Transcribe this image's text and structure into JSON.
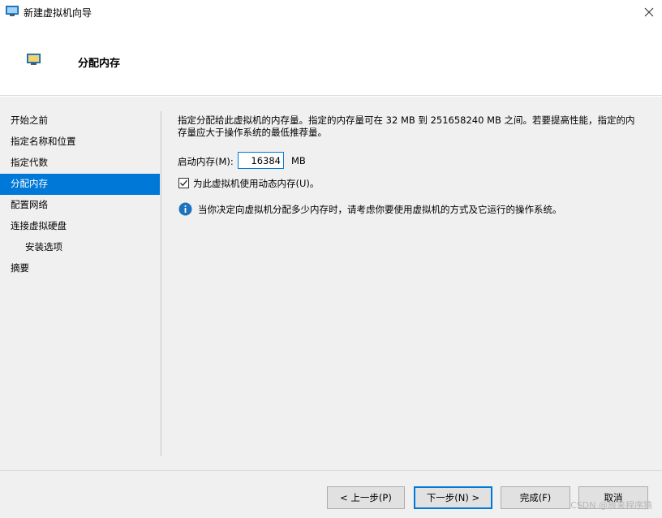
{
  "window": {
    "title": "新建虚拟机向导"
  },
  "header": {
    "title": "分配内存"
  },
  "sidebar": {
    "items": [
      {
        "label": "开始之前"
      },
      {
        "label": "指定名称和位置"
      },
      {
        "label": "指定代数"
      },
      {
        "label": "分配内存"
      },
      {
        "label": "配置网络"
      },
      {
        "label": "连接虚拟硬盘"
      },
      {
        "label": "安装选项"
      },
      {
        "label": "摘要"
      }
    ]
  },
  "content": {
    "description": "指定分配给此虚拟机的内存量。指定的内存量可在 32 MB 到 251658240 MB 之间。若要提高性能，指定的内存量应大于操作系统的最低推荐量。",
    "memory_label": "启动内存(M):",
    "memory_value": "16384",
    "memory_unit": "MB",
    "dynamic_memory_label": "为此虚拟机使用动态内存(U)。",
    "dynamic_memory_checked": true,
    "info_text": "当你决定向虚拟机分配多少内存时，请考虑你要使用虚拟机的方式及它运行的操作系统。"
  },
  "footer": {
    "prev_label": "< 上一步(P)",
    "next_label": "下一步(N) >",
    "finish_label": "完成(F)",
    "cancel_label": "取消"
  },
  "watermark": "CSDN @旅来程序猿",
  "colors": {
    "accent": "#0078d7",
    "panel": "#f0f0f0",
    "info": "#1e73be"
  }
}
